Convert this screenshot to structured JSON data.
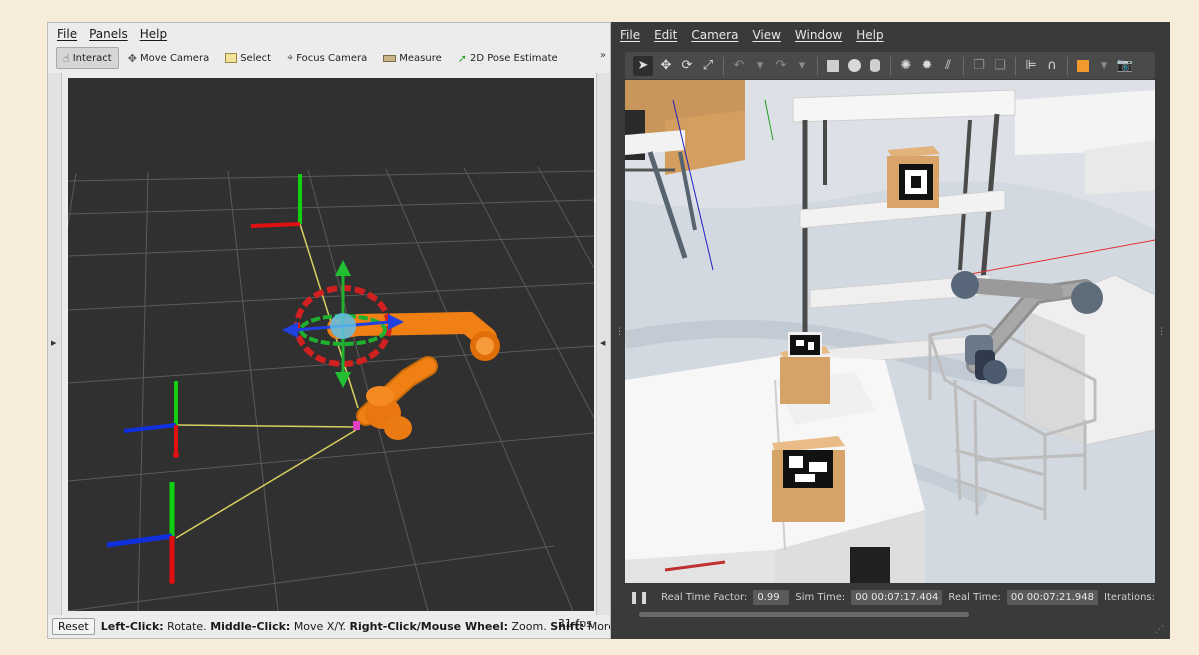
{
  "rviz": {
    "menu": [
      "File",
      "Panels",
      "Help"
    ],
    "tools": [
      {
        "label": "Interact",
        "icon": "hand-pointer-icon"
      },
      {
        "label": "Move Camera",
        "icon": "move-camera-icon"
      },
      {
        "label": "Select",
        "icon": "select-box-icon"
      },
      {
        "label": "Focus Camera",
        "icon": "focus-crosshair-icon"
      },
      {
        "label": "Measure",
        "icon": "ruler-icon"
      },
      {
        "label": "2D Pose Estimate",
        "icon": "green-arrow-icon"
      }
    ],
    "overflow": "»",
    "status": {
      "reset": "Reset",
      "hint_left_key": "Left-Click:",
      "hint_left_val": "Rotate.",
      "hint_mid_key": "Middle-Click:",
      "hint_mid_val": "Move X/Y.",
      "hint_right_key": "Right-Click/Mouse Wheel:",
      "hint_right_val": "Zoom.",
      "hint_shift_key": "Shift:",
      "hint_shift_val": "More op",
      "fps": "31 fps"
    }
  },
  "gazebo": {
    "menu": [
      "File",
      "Edit",
      "Camera",
      "View",
      "Window",
      "Help"
    ],
    "status": {
      "rtf_label": "Real Time Factor:",
      "rtf_value": "0.99",
      "sim_label": "Sim Time:",
      "sim_value": "00 00:07:17.404",
      "real_label": "Real Time:",
      "real_value": "00 00:07:21.948",
      "iter_label": "Iterations:"
    }
  },
  "colors": {
    "rviz_bg": "#303030",
    "robot_orange": "#f07f14",
    "axis_red": "#e01010",
    "axis_green": "#10d010",
    "axis_blue": "#1030e0",
    "tf_line": "#d8d060"
  }
}
